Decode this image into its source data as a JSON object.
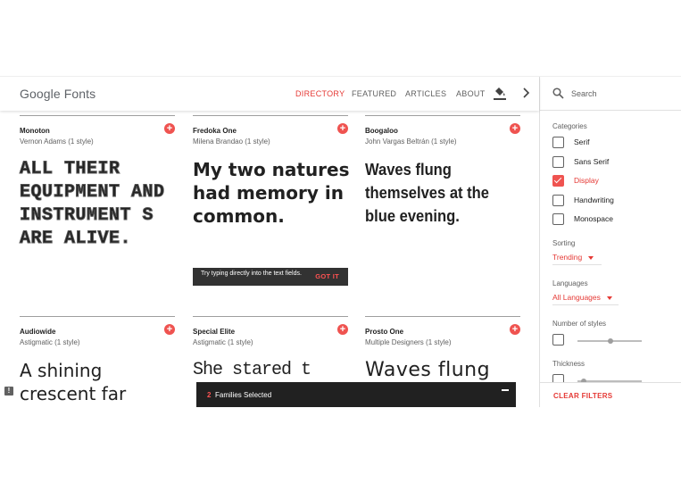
{
  "header": {
    "logo": "Google Fonts",
    "nav": [
      {
        "label": "DIRECTORY",
        "active": true
      },
      {
        "label": "FEATURED",
        "active": false
      },
      {
        "label": "ARTICLES",
        "active": false
      },
      {
        "label": "ABOUT",
        "active": false
      }
    ],
    "icons": {
      "customize": "paint-bucket-icon",
      "more": "chevron-right-icon"
    }
  },
  "cards": [
    {
      "name": "Monoton",
      "designer": "Vernon Adams (1 style)",
      "sample": "ALL THEIR EQUIPMENT AND INSTRUMENT S ARE ALIVE."
    },
    {
      "name": "Fredoka One",
      "designer": "Milena Brandao (1 style)",
      "sample": "My two natures had memory in common."
    },
    {
      "name": "Boogaloo",
      "designer": "John Vargas Beltrán (1 style)",
      "sample": "Waves flung themselves at the blue evening."
    },
    {
      "name": "Audiowide",
      "designer": "Astigmatic (1 style)",
      "sample": "A shining crescent far"
    },
    {
      "name": "Special Elite",
      "designer": "Astigmatic (1 style)",
      "sample": "She stared t"
    },
    {
      "name": "Prosto One",
      "designer": "Multiple Designers (1 style)",
      "sample": "Waves flung"
    }
  ],
  "tooltip": {
    "text": "Try typing directly into the text fields.",
    "action": "GOT IT"
  },
  "drawer": {
    "count": "2",
    "label": "Families Selected"
  },
  "sidebar": {
    "search_placeholder": "Search",
    "categories_heading": "Categories",
    "categories": [
      {
        "label": "Serif",
        "checked": false
      },
      {
        "label": "Sans Serif",
        "checked": false
      },
      {
        "label": "Display",
        "checked": true
      },
      {
        "label": "Handwriting",
        "checked": false
      },
      {
        "label": "Monospace",
        "checked": false
      }
    ],
    "sorting_heading": "Sorting",
    "sorting_value": "Trending",
    "languages_heading": "Languages",
    "languages_value": "All Languages",
    "styles_heading": "Number of styles",
    "thickness_heading": "Thickness",
    "clear_filters": "CLEAR FILTERS"
  },
  "colors": {
    "accent": "#e53935",
    "drawer": "#212121",
    "tooltip": "#323232"
  }
}
